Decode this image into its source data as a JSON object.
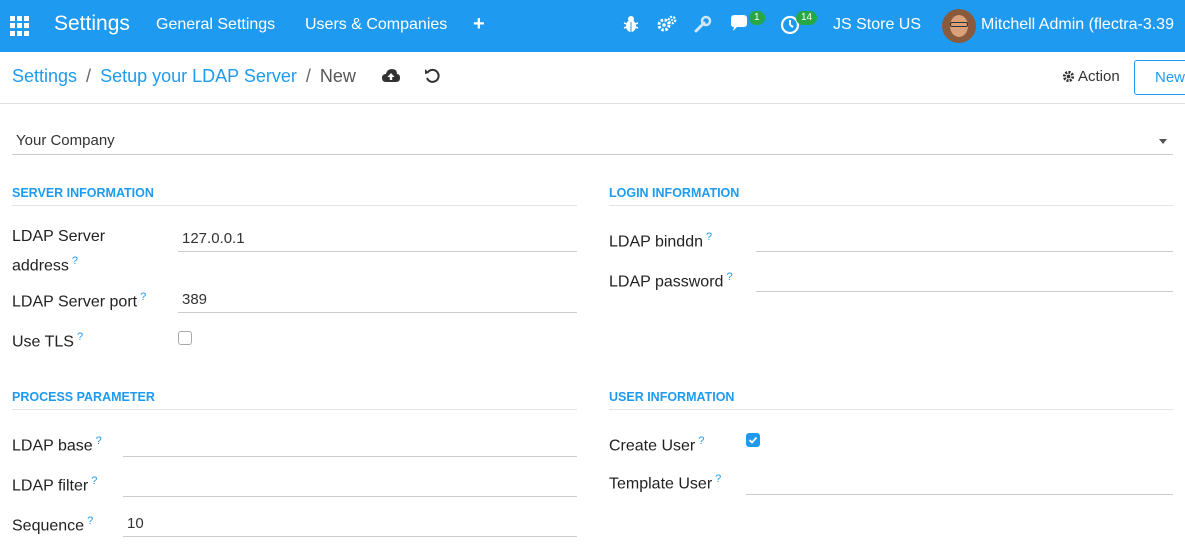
{
  "navbar": {
    "brand": "Settings",
    "menu": [
      "General Settings",
      "Users & Companies"
    ],
    "plus": "+",
    "messages_badge": "1",
    "activities_badge": "14",
    "company": "JS Store US",
    "user": "Mitchell Admin (flectra-3.39"
  },
  "breadcrumb": {
    "root": "Settings",
    "parent": "Setup your LDAP Server",
    "current": "New",
    "sep": "/"
  },
  "control": {
    "action_label": "Action",
    "new_label": "New"
  },
  "form": {
    "company": "Your Company",
    "server_section": "SERVER INFORMATION",
    "login_section": "LOGIN INFORMATION",
    "process_section": "PROCESS PARAMETER",
    "user_section": "USER INFORMATION",
    "server_address_label_1": "LDAP Server",
    "server_address_label_2": "address",
    "server_address_value": "127.0.0.1",
    "server_port_label": "LDAP Server port",
    "server_port_value": "389",
    "use_tls_label": "Use TLS",
    "use_tls_checked": false,
    "binddn_label": "LDAP binddn",
    "binddn_value": "",
    "password_label": "LDAP password",
    "password_value": "",
    "base_label": "LDAP base",
    "base_value": "",
    "filter_label": "LDAP filter",
    "filter_value": "",
    "sequence_label": "Sequence",
    "sequence_value": "10",
    "create_user_label": "Create User",
    "create_user_checked": true,
    "template_user_label": "Template User",
    "template_user_value": "",
    "help_mark": "?"
  },
  "colors": {
    "primary": "#1e9bf0",
    "badge": "#28a745"
  }
}
